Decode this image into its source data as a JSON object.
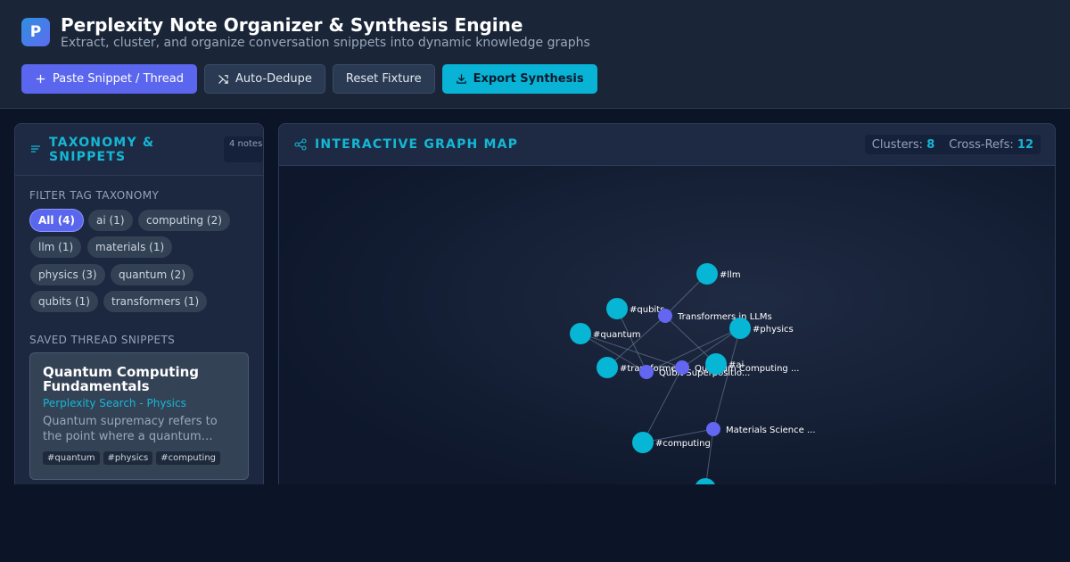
{
  "app": {
    "logo": "P",
    "title": "Perplexity Note Organizer & Synthesis Engine",
    "subtitle": "Extract, cluster, and organize conversation snippets into dynamic knowledge graphs"
  },
  "toolbar": {
    "paste_label": "Paste Snippet / Thread",
    "dedupe_label": "Auto-Dedupe",
    "reset_label": "Reset Fixture",
    "export_label": "Export Synthesis"
  },
  "sidebar": {
    "title": "TAXONOMY & SNIPPETS",
    "count_badge": "4 notes",
    "filter_label": "FILTER TAG TAXONOMY",
    "tags": [
      {
        "label": "All (4)",
        "active": true
      },
      {
        "label": "ai (1)",
        "active": false
      },
      {
        "label": "computing (2)",
        "active": false
      },
      {
        "label": "llm (1)",
        "active": false
      },
      {
        "label": "materials (1)",
        "active": false
      },
      {
        "label": "physics (3)",
        "active": false
      },
      {
        "label": "quantum (2)",
        "active": false
      },
      {
        "label": "qubits (1)",
        "active": false
      },
      {
        "label": "transformers (1)",
        "active": false
      }
    ],
    "saved_label": "SAVED THREAD SNIPPETS",
    "snippets": [
      {
        "title": "Quantum Computing Fundamentals",
        "source": "Perplexity Search - Physics",
        "text": "Quantum supremacy refers to the point where a quantum…",
        "tags": [
          "#quantum",
          "#physics",
          "#computing"
        ]
      }
    ]
  },
  "graph": {
    "title": "INTERACTIVE GRAPH MAP",
    "clusters_label": "Clusters:",
    "clusters_value": "8",
    "crossrefs_label": "Cross-Refs:",
    "crossrefs_value": "12",
    "colors": {
      "tag": "#06b6d4",
      "note": "#6366f1",
      "edge": "#64748b"
    },
    "nodes": [
      {
        "id": "llm",
        "label": "#llm",
        "kind": "tag"
      },
      {
        "id": "qubits",
        "label": "#qubits",
        "kind": "tag"
      },
      {
        "id": "transformers_note",
        "label": "Transformers in LLMs",
        "kind": "note"
      },
      {
        "id": "physics",
        "label": "#physics",
        "kind": "tag"
      },
      {
        "id": "quantum",
        "label": "#quantum",
        "kind": "tag"
      },
      {
        "id": "transformers",
        "label": "#transformers",
        "kind": "tag"
      },
      {
        "id": "qubit_note",
        "label": "Qubit Superpositio...",
        "kind": "note"
      },
      {
        "id": "qc_note",
        "label": "Quantum Computing ...",
        "kind": "note"
      },
      {
        "id": "ai",
        "label": "#ai",
        "kind": "tag"
      },
      {
        "id": "materials_note",
        "label": "Materials Science ...",
        "kind": "note"
      },
      {
        "id": "computing",
        "label": "#computing",
        "kind": "tag"
      },
      {
        "id": "materials",
        "label": "",
        "kind": "tag"
      }
    ],
    "edges": [
      [
        "transformers_note",
        "llm"
      ],
      [
        "transformers_note",
        "transformers"
      ],
      [
        "transformers_note",
        "ai"
      ],
      [
        "qubit_note",
        "qubits"
      ],
      [
        "qubit_note",
        "quantum"
      ],
      [
        "qubit_note",
        "physics"
      ],
      [
        "qc_note",
        "quantum"
      ],
      [
        "qc_note",
        "physics"
      ],
      [
        "qc_note",
        "computing"
      ],
      [
        "materials_note",
        "physics"
      ],
      [
        "materials_note",
        "computing"
      ],
      [
        "materials_note",
        "materials"
      ]
    ]
  }
}
